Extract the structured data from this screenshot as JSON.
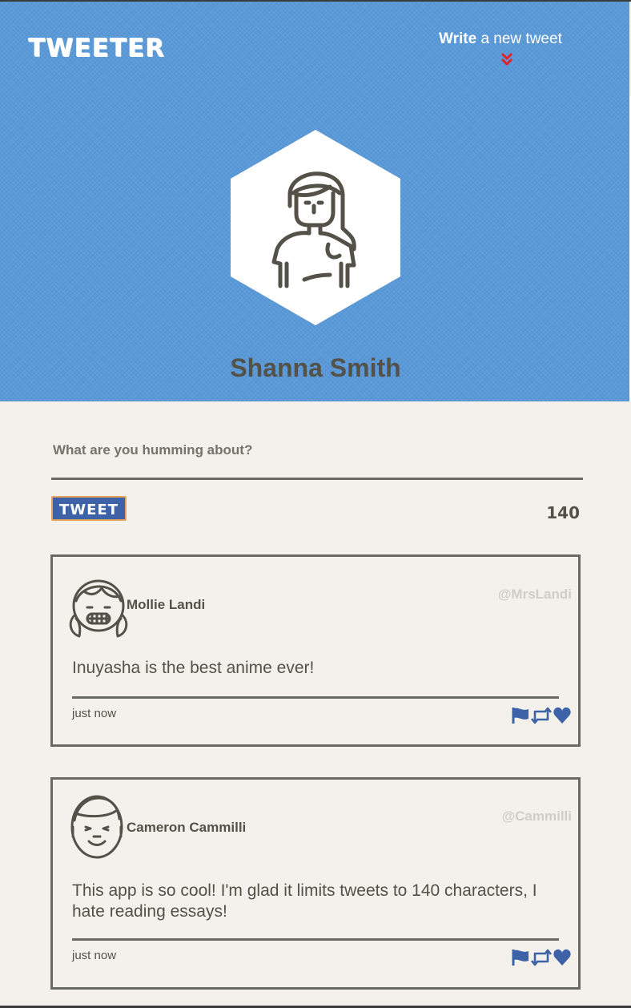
{
  "app": {
    "logo": "TWEETER"
  },
  "header": {
    "compose_toggle_strong": "Write",
    "compose_toggle_rest": " a new tweet",
    "chevron_icon": "double-chevron-down-icon",
    "accent_color": "#e0242a"
  },
  "profile": {
    "name": "Shanna Smith",
    "avatar_icon": "woman-avatar-icon"
  },
  "composer": {
    "prompt": "What are you humming about?",
    "button_label": "TWEET",
    "counter": "140"
  },
  "tweets": [
    {
      "name": "Mollie Landi",
      "handle": "@MrsLandi",
      "body": "Inuyasha is the best anime ever!",
      "time": "just now",
      "avatar_icon": "girl-avatar-icon"
    },
    {
      "name": "Cameron Cammilli",
      "handle": "@Cammilli",
      "body": "This app is so cool! I'm glad it limits tweets to 140 characters, I hate reading essays!",
      "time": "just now",
      "avatar_icon": "boy-avatar-icon"
    }
  ],
  "colors": {
    "header_bg": "#5899d9",
    "page_bg": "#f4f1ec",
    "action_icons": "#3d62a8",
    "button_border": "#e2a45a"
  },
  "action_icons": [
    "flag-icon",
    "retweet-icon",
    "heart-icon"
  ]
}
